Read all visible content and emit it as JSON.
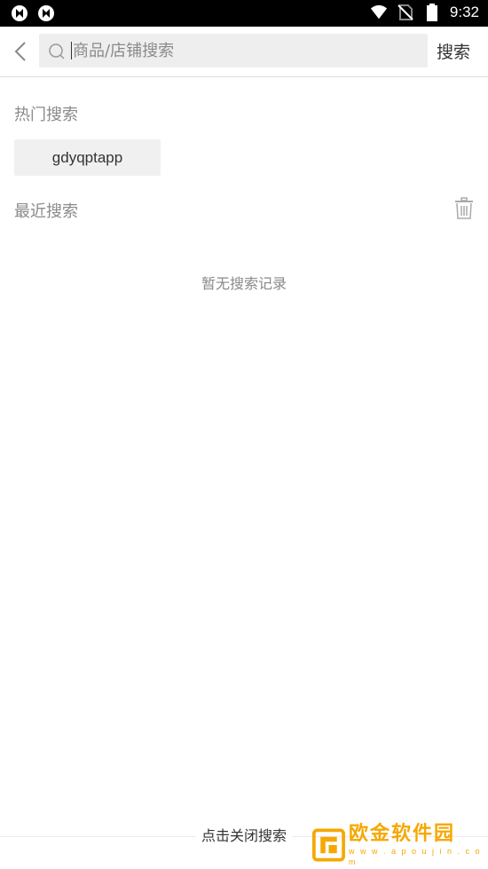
{
  "status_bar": {
    "time": "9:32",
    "left_icons": [
      "app-notification-icon",
      "app-notification-icon"
    ],
    "right_icons": [
      "wifi-icon",
      "no-sim-icon",
      "battery-icon"
    ]
  },
  "header": {
    "back_icon": "chevron-left-icon",
    "search": {
      "placeholder": "商品/店铺搜索",
      "value": ""
    },
    "search_button_label": "搜索"
  },
  "hot_search": {
    "title": "热门搜索",
    "tags": [
      "gdyqptapp"
    ]
  },
  "recent_search": {
    "title": "最近搜索",
    "clear_icon": "trash-icon",
    "empty_text": "暂无搜索记录"
  },
  "footer": {
    "close_label": "点击关闭搜索"
  },
  "watermark": {
    "name": "欧金软件园",
    "url": "w w w . a p o u j i n . c o m"
  },
  "colors": {
    "accent_watermark": "#f6a800",
    "muted_text": "#8a8a8a",
    "tag_bg": "#f0f0f0",
    "search_bg": "#eeeeee"
  }
}
